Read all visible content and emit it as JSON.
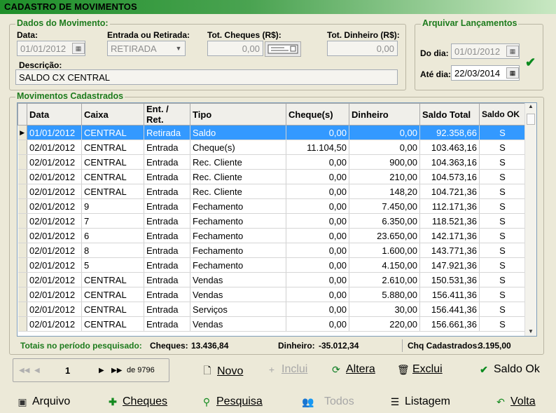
{
  "window": {
    "title": "CADASTRO DE MOVIMENTOS"
  },
  "dados": {
    "legend": "Dados do Movimento:",
    "data_label": "Data:",
    "data_value": "01/01/2012",
    "entrada_label": "Entrada ou Retirada:",
    "entrada_value": "RETIRADA",
    "tot_cheques_label": "Tot. Cheques (R$):",
    "tot_cheques_value": "0,00",
    "tot_dinheiro_label": "Tot. Dinheiro (R$):",
    "tot_dinheiro_value": "0,00",
    "descricao_label": "Descrição:",
    "descricao_value": "SALDO CX CENTRAL"
  },
  "arquivar": {
    "legend": "Arquivar Lançamentos",
    "do_dia_label": "Do dia:",
    "do_dia_value": "01/01/2012",
    "ate_dia_label": "Até dia:",
    "ate_dia_value": "22/03/2014"
  },
  "movimentos": {
    "legend": "Movimentos Cadastrados",
    "columns": [
      "Data",
      "Caixa",
      "Ent. / Ret.",
      "Tipo",
      "Cheque(s)",
      "Dinheiro",
      "Saldo Total",
      "Saldo OK"
    ],
    "rows": [
      [
        "01/01/2012",
        "CENTRAL",
        "Retirada",
        "Saldo",
        "0,00",
        "0,00",
        "92.358,66",
        "S"
      ],
      [
        "02/01/2012",
        "CENTRAL",
        "Entrada",
        "Cheque(s)",
        "11.104,50",
        "0,00",
        "103.463,16",
        "S"
      ],
      [
        "02/01/2012",
        "CENTRAL",
        "Entrada",
        "Rec. Cliente",
        "0,00",
        "900,00",
        "104.363,16",
        "S"
      ],
      [
        "02/01/2012",
        "CENTRAL",
        "Entrada",
        "Rec. Cliente",
        "0,00",
        "210,00",
        "104.573,16",
        "S"
      ],
      [
        "02/01/2012",
        "CENTRAL",
        "Entrada",
        "Rec. Cliente",
        "0,00",
        "148,20",
        "104.721,36",
        "S"
      ],
      [
        "02/01/2012",
        "9",
        "Entrada",
        "Fechamento",
        "0,00",
        "7.450,00",
        "112.171,36",
        "S"
      ],
      [
        "02/01/2012",
        "7",
        "Entrada",
        "Fechamento",
        "0,00",
        "6.350,00",
        "118.521,36",
        "S"
      ],
      [
        "02/01/2012",
        "6",
        "Entrada",
        "Fechamento",
        "0,00",
        "23.650,00",
        "142.171,36",
        "S"
      ],
      [
        "02/01/2012",
        "8",
        "Entrada",
        "Fechamento",
        "0,00",
        "1.600,00",
        "143.771,36",
        "S"
      ],
      [
        "02/01/2012",
        "5",
        "Entrada",
        "Fechamento",
        "0,00",
        "4.150,00",
        "147.921,36",
        "S"
      ],
      [
        "02/01/2012",
        "CENTRAL",
        "Entrada",
        "Vendas",
        "0,00",
        "2.610,00",
        "150.531,36",
        "S"
      ],
      [
        "02/01/2012",
        "CENTRAL",
        "Entrada",
        "Vendas",
        "0,00",
        "5.880,00",
        "156.411,36",
        "S"
      ],
      [
        "02/01/2012",
        "CENTRAL",
        "Entrada",
        "Serviços",
        "0,00",
        "30,00",
        "156.441,36",
        "S"
      ],
      [
        "02/01/2012",
        "CENTRAL",
        "Entrada",
        "Vendas",
        "0,00",
        "220,00",
        "156.661,36",
        "S"
      ]
    ]
  },
  "totais": {
    "label": "Totais no período pesquisado:",
    "cheques_label": "Cheques:",
    "cheques_value": "13.436,84",
    "dinheiro_label": "Dinheiro:",
    "dinheiro_value": "-35.012,34",
    "chq_label": "Chq Cadastrados:",
    "chq_value": "3.195,00"
  },
  "navigator": {
    "record": "1",
    "of_label": "de 9796"
  },
  "actions": {
    "novo": "Novo",
    "inclui": "Inclui",
    "altera": "Altera",
    "exclui": "Exclui",
    "saldo_ok": "Saldo Ok"
  },
  "bottom": {
    "arquivo": "Arquivo",
    "cheques": "Cheques",
    "pesquisa": "Pesquisa",
    "todos": "Todos",
    "listagem": "Listagem",
    "volta": "Volta"
  },
  "icons": [
    "calendar-icon",
    "dropdown-arrow-icon",
    "cheque-icon",
    "check-icon",
    "page-icon",
    "plus-icon",
    "refresh-icon",
    "trash-icon",
    "disk-icon",
    "search-icon",
    "users-icon",
    "list-icon",
    "back-arrow-icon"
  ],
  "colors": {
    "title_gradient_start": "#1f8f2a",
    "legend_green": "#1d7b1d",
    "selection": "#3399ff",
    "window_bg": "#ece9d8"
  }
}
